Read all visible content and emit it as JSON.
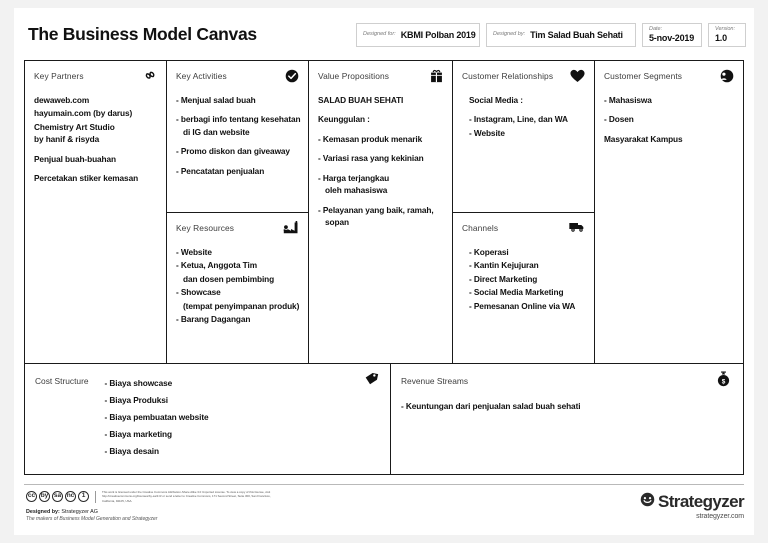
{
  "header": {
    "title": "The Business Model Canvas",
    "meta": [
      {
        "label": "Designed for:",
        "value": "KBMI Polban 2019",
        "name": "designed-for"
      },
      {
        "label": "Designed by:",
        "value": "Tim Salad Buah Sehati",
        "name": "designed-by"
      },
      {
        "label": "Date:",
        "value": "5-nov-2019",
        "name": "date"
      },
      {
        "label": "Version:",
        "value": "1.0",
        "name": "version"
      }
    ]
  },
  "blocks": {
    "key_partners": {
      "title": "Key Partners",
      "icon": "chain-link-icon",
      "lines": [
        "dewaweb.com",
        "hayumain.com (by darus)",
        "Chemistry Art Studio",
        "by hanif & risyda",
        "Penjual buah-buahan",
        "Percetakan stiker kemasan"
      ]
    },
    "key_activities": {
      "title": "Key Activities",
      "icon": "check-circle-icon",
      "lines": [
        "- Menjual salad buah",
        "- berbagi info tentang kesehatan",
        "di IG dan website",
        "- Promo diskon dan giveaway",
        "- Pencatatan penjualan"
      ]
    },
    "key_resources": {
      "title": "Key Resources",
      "icon": "factory-icon",
      "lines": [
        "- Website",
        "- Ketua, Anggota Tim",
        "dan dosen pembimbing",
        "- Showcase",
        "(tempat penyimpanan produk)",
        "- Barang Dagangan"
      ]
    },
    "value_propositions": {
      "title": "Value Propositions",
      "icon": "gift-package-icon",
      "lines": [
        "SALAD BUAH SEHATI",
        "Keunggulan :",
        "- Kemasan produk menarik",
        "- Variasi rasa yang kekinian",
        "- Harga terjangkau",
        "oleh mahasiswa",
        "- Pelayanan yang baik, ramah,",
        "sopan"
      ]
    },
    "customer_relationships": {
      "title": "Customer Relationships",
      "icon": "heart-icon",
      "lines": [
        "Social Media :",
        "- Instagram, Line, dan WA",
        "- Website"
      ]
    },
    "channels": {
      "title": "Channels",
      "icon": "delivery-truck-icon",
      "lines": [
        "- Koperasi",
        "- Kantin Kejujuran",
        "- Direct Marketing",
        "- Social Media Marketing",
        "- Pemesanan Online via WA"
      ]
    },
    "customer_segments": {
      "title": "Customer Segments",
      "icon": "person-circle-icon",
      "lines": [
        "- Mahasiswa",
        "- Dosen",
        "Masyarakat Kampus"
      ]
    },
    "cost_structure": {
      "title": "Cost Structure",
      "icon": "price-tag-icon",
      "lines": [
        "- Biaya showcase",
        "- Biaya Produksi",
        "- Biaya pembuatan website",
        "- Biaya marketing",
        "- Biaya desain"
      ]
    },
    "revenue_streams": {
      "title": "Revenue Streams",
      "icon": "money-bag-icon",
      "lines": [
        "- Keuntungan dari penjualan salad buah sehati"
      ]
    }
  },
  "footer": {
    "cc_badges": [
      "cc",
      "by",
      "sa",
      "nc",
      "1"
    ],
    "legal": "This work is licensed under the Creative Commons Attribution-Share Alike 3.0 Unported License. To view a copy of this license, visit http://creativecommons.org/licenses/by-sa/3.0/ or send a letter to Creative Commons, 171 Second Street, Suite 300, San Francisco, California, 94105, USA.",
    "designed_label": "Designed by:",
    "designed_value": "Strategyzer AG",
    "designed_sub": "The makers of Business Model Generation and Strategyzer",
    "brand_name": "Strategyzer",
    "brand_url": "strategyzer.com"
  },
  "colors": {
    "ink": "#1a1a1a",
    "page_bg": "#f2f2f2",
    "sheet_bg": "#ffffff",
    "muted": "#3d3d3d"
  }
}
